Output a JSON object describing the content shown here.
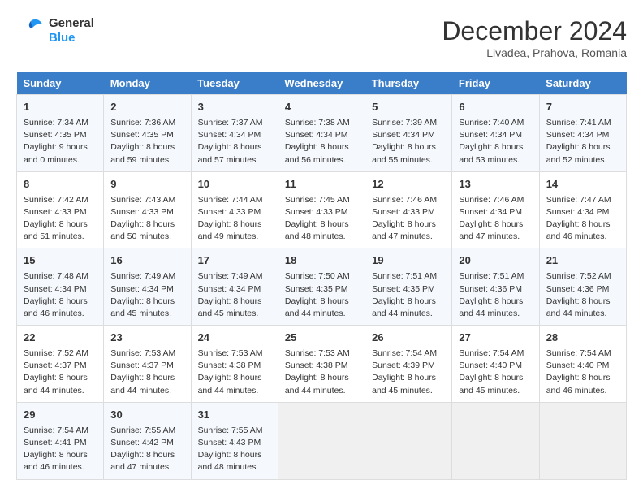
{
  "header": {
    "logo_line1": "General",
    "logo_line2": "Blue",
    "month": "December 2024",
    "location": "Livadea, Prahova, Romania"
  },
  "columns": [
    "Sunday",
    "Monday",
    "Tuesday",
    "Wednesday",
    "Thursday",
    "Friday",
    "Saturday"
  ],
  "weeks": [
    [
      {
        "day": "1",
        "info": "Sunrise: 7:34 AM\nSunset: 4:35 PM\nDaylight: 9 hours\nand 0 minutes."
      },
      {
        "day": "2",
        "info": "Sunrise: 7:36 AM\nSunset: 4:35 PM\nDaylight: 8 hours\nand 59 minutes."
      },
      {
        "day": "3",
        "info": "Sunrise: 7:37 AM\nSunset: 4:34 PM\nDaylight: 8 hours\nand 57 minutes."
      },
      {
        "day": "4",
        "info": "Sunrise: 7:38 AM\nSunset: 4:34 PM\nDaylight: 8 hours\nand 56 minutes."
      },
      {
        "day": "5",
        "info": "Sunrise: 7:39 AM\nSunset: 4:34 PM\nDaylight: 8 hours\nand 55 minutes."
      },
      {
        "day": "6",
        "info": "Sunrise: 7:40 AM\nSunset: 4:34 PM\nDaylight: 8 hours\nand 53 minutes."
      },
      {
        "day": "7",
        "info": "Sunrise: 7:41 AM\nSunset: 4:34 PM\nDaylight: 8 hours\nand 52 minutes."
      }
    ],
    [
      {
        "day": "8",
        "info": "Sunrise: 7:42 AM\nSunset: 4:33 PM\nDaylight: 8 hours\nand 51 minutes."
      },
      {
        "day": "9",
        "info": "Sunrise: 7:43 AM\nSunset: 4:33 PM\nDaylight: 8 hours\nand 50 minutes."
      },
      {
        "day": "10",
        "info": "Sunrise: 7:44 AM\nSunset: 4:33 PM\nDaylight: 8 hours\nand 49 minutes."
      },
      {
        "day": "11",
        "info": "Sunrise: 7:45 AM\nSunset: 4:33 PM\nDaylight: 8 hours\nand 48 minutes."
      },
      {
        "day": "12",
        "info": "Sunrise: 7:46 AM\nSunset: 4:33 PM\nDaylight: 8 hours\nand 47 minutes."
      },
      {
        "day": "13",
        "info": "Sunrise: 7:46 AM\nSunset: 4:34 PM\nDaylight: 8 hours\nand 47 minutes."
      },
      {
        "day": "14",
        "info": "Sunrise: 7:47 AM\nSunset: 4:34 PM\nDaylight: 8 hours\nand 46 minutes."
      }
    ],
    [
      {
        "day": "15",
        "info": "Sunrise: 7:48 AM\nSunset: 4:34 PM\nDaylight: 8 hours\nand 46 minutes."
      },
      {
        "day": "16",
        "info": "Sunrise: 7:49 AM\nSunset: 4:34 PM\nDaylight: 8 hours\nand 45 minutes."
      },
      {
        "day": "17",
        "info": "Sunrise: 7:49 AM\nSunset: 4:34 PM\nDaylight: 8 hours\nand 45 minutes."
      },
      {
        "day": "18",
        "info": "Sunrise: 7:50 AM\nSunset: 4:35 PM\nDaylight: 8 hours\nand 44 minutes."
      },
      {
        "day": "19",
        "info": "Sunrise: 7:51 AM\nSunset: 4:35 PM\nDaylight: 8 hours\nand 44 minutes."
      },
      {
        "day": "20",
        "info": "Sunrise: 7:51 AM\nSunset: 4:36 PM\nDaylight: 8 hours\nand 44 minutes."
      },
      {
        "day": "21",
        "info": "Sunrise: 7:52 AM\nSunset: 4:36 PM\nDaylight: 8 hours\nand 44 minutes."
      }
    ],
    [
      {
        "day": "22",
        "info": "Sunrise: 7:52 AM\nSunset: 4:37 PM\nDaylight: 8 hours\nand 44 minutes."
      },
      {
        "day": "23",
        "info": "Sunrise: 7:53 AM\nSunset: 4:37 PM\nDaylight: 8 hours\nand 44 minutes."
      },
      {
        "day": "24",
        "info": "Sunrise: 7:53 AM\nSunset: 4:38 PM\nDaylight: 8 hours\nand 44 minutes."
      },
      {
        "day": "25",
        "info": "Sunrise: 7:53 AM\nSunset: 4:38 PM\nDaylight: 8 hours\nand 44 minutes."
      },
      {
        "day": "26",
        "info": "Sunrise: 7:54 AM\nSunset: 4:39 PM\nDaylight: 8 hours\nand 45 minutes."
      },
      {
        "day": "27",
        "info": "Sunrise: 7:54 AM\nSunset: 4:40 PM\nDaylight: 8 hours\nand 45 minutes."
      },
      {
        "day": "28",
        "info": "Sunrise: 7:54 AM\nSunset: 4:40 PM\nDaylight: 8 hours\nand 46 minutes."
      }
    ],
    [
      {
        "day": "29",
        "info": "Sunrise: 7:54 AM\nSunset: 4:41 PM\nDaylight: 8 hours\nand 46 minutes."
      },
      {
        "day": "30",
        "info": "Sunrise: 7:55 AM\nSunset: 4:42 PM\nDaylight: 8 hours\nand 47 minutes."
      },
      {
        "day": "31",
        "info": "Sunrise: 7:55 AM\nSunset: 4:43 PM\nDaylight: 8 hours\nand 48 minutes."
      },
      {
        "day": "",
        "info": ""
      },
      {
        "day": "",
        "info": ""
      },
      {
        "day": "",
        "info": ""
      },
      {
        "day": "",
        "info": ""
      }
    ]
  ]
}
